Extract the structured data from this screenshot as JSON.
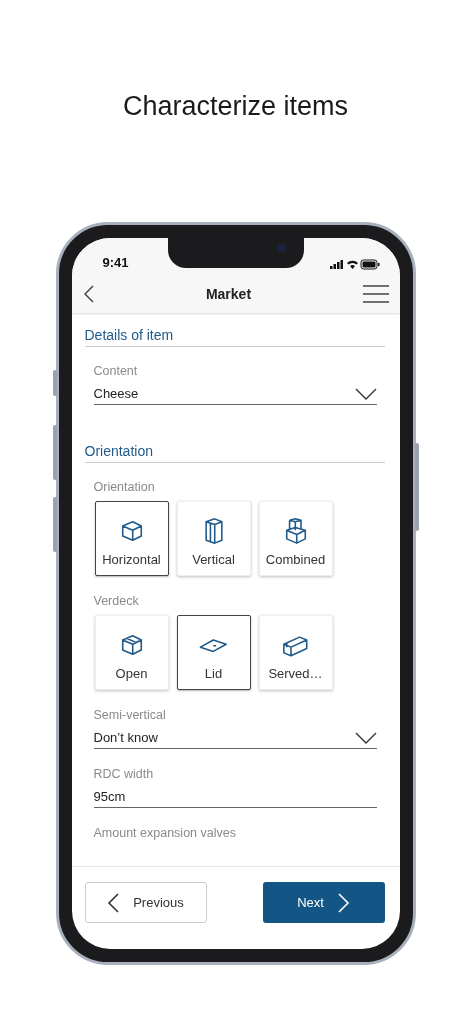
{
  "headline": "Characterize items",
  "status_bar": {
    "time": "9:41"
  },
  "nav": {
    "title": "Market"
  },
  "sections": [
    {
      "title": "Details of item",
      "fields": [
        {
          "kind": "select",
          "label": "Content",
          "value": "Cheese"
        }
      ]
    },
    {
      "title": "Orientation",
      "fields": [
        {
          "kind": "choices",
          "label": "Orientation",
          "options": [
            {
              "label": "Horizontal",
              "kind": "box",
              "selected": true
            },
            {
              "label": "Vertical",
              "kind": "tall",
              "selected": false
            },
            {
              "label": "Combined",
              "kind": "combined",
              "selected": false
            }
          ]
        },
        {
          "kind": "choices",
          "label": "Verdeck",
          "options": [
            {
              "label": "Open",
              "kind": "open",
              "selected": false
            },
            {
              "label": "Lid",
              "kind": "lid",
              "selected": true
            },
            {
              "label": "Served…",
              "kind": "served",
              "selected": false
            }
          ]
        },
        {
          "kind": "select",
          "label": "Semi-vertical",
          "value": "Don’t know"
        },
        {
          "kind": "text",
          "label": "RDC width",
          "value": "95cm"
        },
        {
          "kind": "label",
          "label": "Amount expansion valves"
        }
      ]
    }
  ],
  "footer": {
    "previous": "Previous",
    "next": "Next"
  }
}
